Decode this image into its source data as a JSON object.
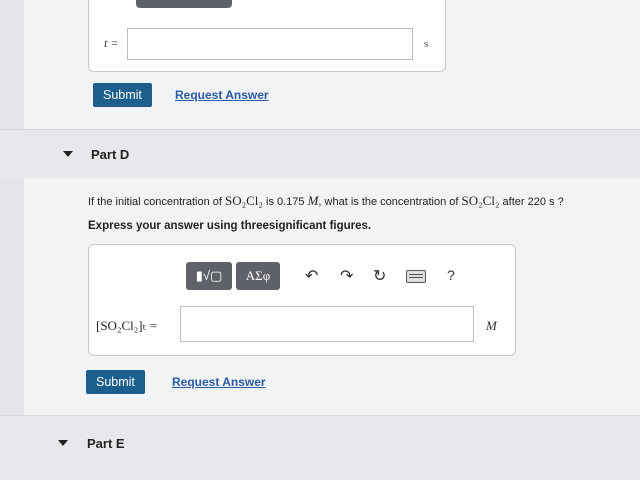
{
  "prev_part": {
    "var_label": "t =",
    "unit": "s",
    "submit_label": "Submit",
    "request_label": "Request Answer"
  },
  "part_d": {
    "title": "Part D",
    "question_pre": "If the initial concentration of ",
    "q_species": "SO₂Cl₂",
    "question_mid": " is 0.175 ",
    "q_unit": "M",
    "question_mid2": ", what is the concentration of ",
    "q_species2": "SO₂Cl₂",
    "question_post": " after 220 s ?",
    "instruction": "Express your answer using threesignificant figures.",
    "toolbar": {
      "math_templates": "▮√▢",
      "greek": "ΑΣφ",
      "undo": "↶",
      "redo": "↷",
      "reset": "↻",
      "help": "?"
    },
    "answer_label": "[SO₂Cl₂]ₜ =",
    "answer_value": "",
    "answer_unit": "M",
    "submit_label": "Submit",
    "request_label": "Request Answer"
  },
  "part_e": {
    "title": "Part E"
  }
}
